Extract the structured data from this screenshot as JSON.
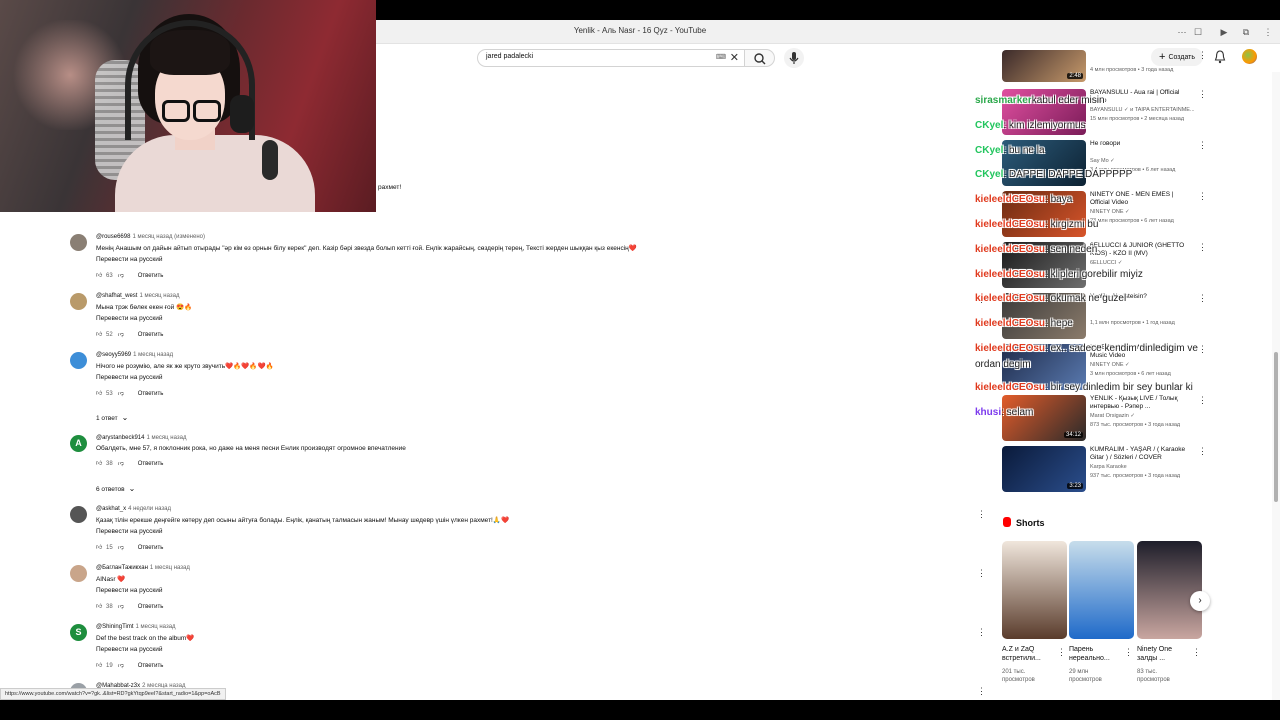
{
  "window": {
    "title": "Yenlik - Аль Nasr - 16 Qyz - YouTube"
  },
  "masthead": {
    "search_value": "jared padalecki",
    "create_label": "Создать"
  },
  "comments": [
    {
      "author": "",
      "time": "",
      "text": "рахмет!",
      "likes": "5",
      "reply": "Ответить",
      "avatar_letter": "",
      "avatar_color": "#888888"
    },
    {
      "author": "@rouse6698",
      "time": "1 месяц назад (изменено)",
      "text": "Менің Анашым ол дайын айтып отырады \"әр кім өз орнын білу керек\" деп. Казір бәрі звезда болып кетті ғой. Еңлік жарайсың, сөздерің терең, Тексті жерден шыққан қыз екенсің❤️",
      "translate": "Перевести на русский",
      "likes": "63",
      "reply": "Ответить",
      "avatar_letter": "",
      "avatar_color": "#8a7f74"
    },
    {
      "author": "@shafhat_west",
      "time": "1 месяц назад",
      "text": "Мына трэк бөлек екен ғой 😍🔥",
      "translate": "Перевести на русский",
      "likes": "52",
      "reply": "Ответить",
      "avatar_letter": "",
      "avatar_color": "#b99a6a"
    },
    {
      "author": "@seoyy5969",
      "time": "1 месяц назад",
      "text": "Нічого не розумію, але як же круто звучить❤️🔥❤️🔥❤️🔥",
      "translate": "Перевести на русский",
      "likes": "53",
      "reply": "Ответить",
      "avatar_letter": "",
      "avatar_color": "#3d8ed8"
    },
    {
      "author": "@arystanbeck914",
      "time": "1 месяц назад",
      "text": "Обалдеть, мне 57, я поклонник рока, но даже на меня песни Енлик производят огромное впечатление",
      "translate": "",
      "likes": "38",
      "reply": "Ответить",
      "avatar_letter": "A",
      "avatar_color": "#1e8e3e"
    },
    {
      "author": "@askhat_x",
      "time": "4 недели назад",
      "text": "Қазақ тілін ерекше деңгейге көтеру деп осыны айтуға болады. Еңлік, қанатың талмасын жаным! Мынау шедевр үшін үлкен рахмет!🙏❤️",
      "translate": "Перевести на русский",
      "likes": "15",
      "reply": "Ответить",
      "avatar_letter": "",
      "avatar_color": "#555555"
    },
    {
      "author": "@БагланТажикхан",
      "time": "1 месяц назад",
      "text": "AlNasr ❤️",
      "translate": "Перевести на русский",
      "likes": "38",
      "reply": "Ответить",
      "avatar_letter": "",
      "avatar_color": "#c9a58a"
    },
    {
      "author": "@ShiningTimt",
      "time": "1 месяц назад",
      "text": "Def the best track on the album❤️",
      "translate": "Перевести на русский",
      "likes": "19",
      "reply": "Ответить",
      "avatar_letter": "S",
      "avatar_color": "#1e8e3e"
    },
    {
      "author": "@Mahabbat-z3x",
      "time": "2 месяца назад",
      "text": "",
      "translate": "",
      "likes": "",
      "reply": "",
      "avatar_letter": "",
      "avatar_color": "#9aa0a6"
    }
  ],
  "replies_toggles": [
    "1 ответ",
    "6 ответов"
  ],
  "recommendations": [
    {
      "title": "",
      "channel": "",
      "meta": "4 млн просмотров • 3 года назад",
      "duration": "2:48",
      "thumb": [
        "#3b2a2a",
        "#c79a6b"
      ]
    },
    {
      "title": "BAYANSULU - Aua rai | Official Video",
      "channel": "BAYANSULU ✓ и TAIPA ENTERTAINME...",
      "meta": "15 млн просмотров • 2 месяца назад",
      "duration": "",
      "thumb": [
        "#e04fa0",
        "#7a1c58"
      ]
    },
    {
      "title": "Не говори",
      "channel": "Say Mo ✓",
      "meta": "3,4 млн просмотров • 6 лет назад",
      "duration": "",
      "thumb": [
        "#2c5b7a",
        "#0d2233"
      ]
    },
    {
      "title": "NINETY ONE - MEN EMES | Official Video",
      "channel": "NINETY ONE ✓",
      "meta": "23 млн просмотров • 6 лет назад",
      "duration": "",
      "thumb": [
        "#6b2b12",
        "#d7542a"
      ]
    },
    {
      "title": "6ELLUCCI & JUNIOR (GHETTO KIDS) - KZO II (MV)",
      "channel": "6ELLUCCI ✓",
      "meta": "",
      "duration": "",
      "thumb": [
        "#1a1a1a",
        "#6e6e6e"
      ]
    },
    {
      "title": "Yenlik - Ne Isteisin?",
      "channel": "",
      "meta": "1,1 млн просмотров • 1 год назад",
      "duration": "",
      "thumb": [
        "#3a3a3a",
        "#8b7b6b"
      ]
    },
    {
      "title": "NINETY ONE - WHY'M | Official Music Video",
      "channel": "NINETY ONE ✓",
      "meta": "3 млн просмотров • 6 лет назад",
      "duration": "",
      "thumb": [
        "#1e2b4a",
        "#5a7ab0"
      ]
    },
    {
      "title": "YENLIK - Қызық LIVE / Толық интервью - Рэпер ...",
      "channel": "Marat Orsigazin ✓",
      "meta": "873 тыс. просмотров • 3 года назад",
      "duration": "34:12",
      "thumb": [
        "#e35c2a",
        "#2a2a2a"
      ]
    },
    {
      "title": "KUMRALIM - YAŞAR / ( Karaoke Gitar ) / Sözleri / COVER",
      "channel": "Karpa Karaoke",
      "meta": "937 тыс. просмотров • 3 года назад",
      "duration": "3:23",
      "thumb": [
        "#0a1a3a",
        "#2b4e8c"
      ]
    }
  ],
  "shorts": {
    "title": "Shorts",
    "items": [
      {
        "title": "A.Z и ZaQ встретили...",
        "views": "201 тыс. просмотров",
        "thumb": [
          "#f0e6dc",
          "#5a3c2c"
        ]
      },
      {
        "title": "Парень нереально...",
        "views": "29 млн просмотров",
        "thumb": [
          "#c7ddeb",
          "#1f6ac9"
        ]
      },
      {
        "title": "Ninety One залды ...",
        "views": "83 тыс. просмотров",
        "thumb": [
          "#1e1e2a",
          "#c9a6a0"
        ]
      }
    ]
  },
  "status_url": "https://www.youtube.com/watch?v=?gk..&list=RD?gkYtqp9eeI?&start_radio=1&pp=oAcB",
  "chat": [
    {
      "user": "sirasmarker",
      "msg": "kabul eder misin",
      "color": "#2aa84a"
    },
    {
      "user": "CKyel",
      "msg": ": kim izlemiyormus",
      "color": "#22c55e"
    },
    {
      "user": "CKyel",
      "msg": ": bu ne la",
      "color": "#22c55e"
    },
    {
      "user": "CKyel",
      "msg": ": DAPPEI DAPPE DAPPPPP",
      "color": "#22c55e"
    },
    {
      "user": "kieleeldCEOsu",
      "msg": ": baya",
      "color": "#e03a1e"
    },
    {
      "user": "kieleeldCEOsu",
      "msg": ": kirgizmi bu",
      "color": "#e03a1e"
    },
    {
      "user": "kieleeldCEOsu",
      "msg": ": sen neden",
      "color": "#e03a1e"
    },
    {
      "user": "kieleeldCEOsu",
      "msg": ": klipleri gorebilir miyiz",
      "color": "#e03a1e"
    },
    {
      "user": "kieleeldCEOsu",
      "msg": ": okumak ne guzel",
      "color": "#e03a1e"
    },
    {
      "user": "kieleeldCEOsu",
      "msg": ": hepe",
      "color": "#e03a1e"
    },
    {
      "user": "kieleeldCEOsu",
      "msg": ": ex.. sadece kendim dinledigim ve",
      "color": "#e03a1e"
    },
    {
      "user": "",
      "msg": "ordan degim",
      "color": "#222222"
    },
    {
      "user": "kieleeldCEOsu",
      "msg": ": bir sey dinledim bir sey bunlar ki",
      "color": "#e03a1e"
    },
    {
      "user": "khusi",
      "msg": ": selam",
      "color": "#7c3aed"
    }
  ]
}
